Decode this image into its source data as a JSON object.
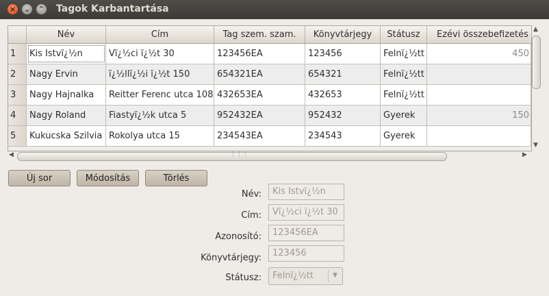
{
  "window": {
    "title": "Tagok Karbantartása"
  },
  "table": {
    "columns": [
      "Név",
      "Cím",
      "Tag szem. szam.",
      "Könyvtárjegy",
      "Státusz",
      "Ezévi összebefizetés"
    ],
    "rows": [
      {
        "num": "1",
        "cells": [
          "Kis Istvï¿½n",
          "Vï¿½ci ï¿½t 30",
          "123456EA",
          "123456",
          "Felnï¿½tt",
          "450"
        ]
      },
      {
        "num": "2",
        "cells": [
          "Nagy Ervin",
          "ï¿½llï¿½i ï¿½t 150",
          "654321EA",
          "654321",
          "Felnï¿½tt",
          ""
        ]
      },
      {
        "num": "3",
        "cells": [
          "Nagy Hajnalka",
          "Reitter Ferenc utca 108",
          "432653EA",
          "432653",
          "Felnï¿½tt",
          ""
        ]
      },
      {
        "num": "4",
        "cells": [
          "Nagy Roland",
          "Fiastyï¿½k utca 5",
          "952432EA",
          "952432",
          "Gyerek",
          "150"
        ]
      },
      {
        "num": "5",
        "cells": [
          "Kukucska Szilvia",
          "Rokolya utca 15",
          "234543EA",
          "234543",
          "Gyerek",
          ""
        ]
      }
    ]
  },
  "buttons": {
    "new_row": "Új sor",
    "modify": "Módosítás",
    "delete": "Törlés"
  },
  "form": {
    "name_label": "Név:",
    "name_value": "Kis Istvï¿½n",
    "address_label": "Cím:",
    "address_value": "Vï¿½ci ï¿½t 30",
    "id_label": "Azonosító:",
    "id_value": "123456EA",
    "card_label": "Könyvtárjegy:",
    "card_value": "123456",
    "status_label": "Státusz:",
    "status_value": "Felnï¿½tt"
  },
  "icons": {
    "close": "close-icon",
    "minimize": "minimize-icon",
    "maximize": "maximize-icon",
    "dropdown": "chevron-down-icon"
  }
}
